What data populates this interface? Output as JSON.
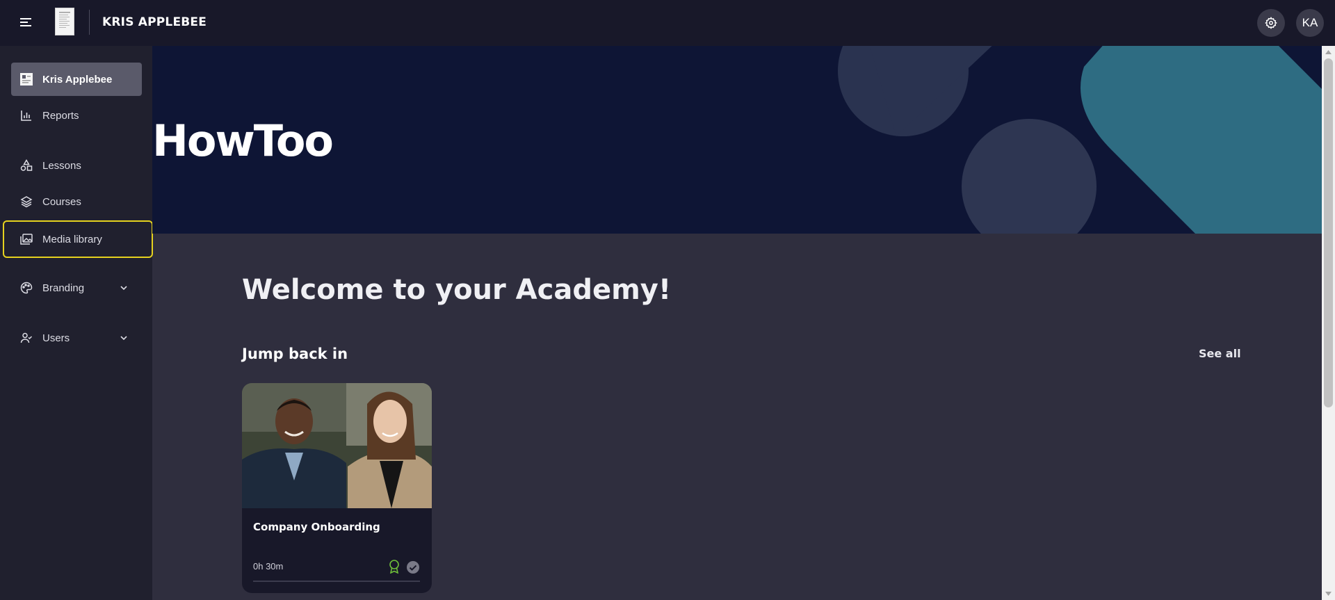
{
  "header": {
    "menu_icon": "hamburger-menu-icon",
    "brand_title": "KRIS APPLEBEE",
    "settings_icon": "gear-icon",
    "avatar_initials": "KA"
  },
  "sidebar": {
    "items": [
      {
        "label": "Kris Applebee",
        "icon": "academy-logo-icon",
        "active": true
      },
      {
        "label": "Reports",
        "icon": "bar-chart-icon"
      },
      {
        "label": "Lessons",
        "icon": "shapes-icon"
      },
      {
        "label": "Courses",
        "icon": "layers-icon"
      },
      {
        "label": "Media library",
        "icon": "image-gallery-icon",
        "highlighted": true
      },
      {
        "label": "Branding",
        "icon": "palette-icon",
        "expandable": true
      },
      {
        "label": "Users",
        "icon": "users-icon",
        "expandable": true
      }
    ]
  },
  "hero": {
    "title": "HowToo"
  },
  "main": {
    "welcome_heading": "Welcome to your Academy!",
    "section_title": "Jump back in",
    "see_all_label": "See all",
    "courses": [
      {
        "title": "Company Onboarding",
        "duration": "0h 30m",
        "progress": 0,
        "status_icons": [
          "award-icon",
          "check-circle-icon"
        ]
      }
    ]
  },
  "colors": {
    "topbar": "#181829",
    "sidebar": "#20202e",
    "content": "#2f2e3e",
    "hero": "#0e1535",
    "highlight": "#e6d21e",
    "accent_teal": "#2e6c82",
    "award_green": "#6fbf3a"
  }
}
